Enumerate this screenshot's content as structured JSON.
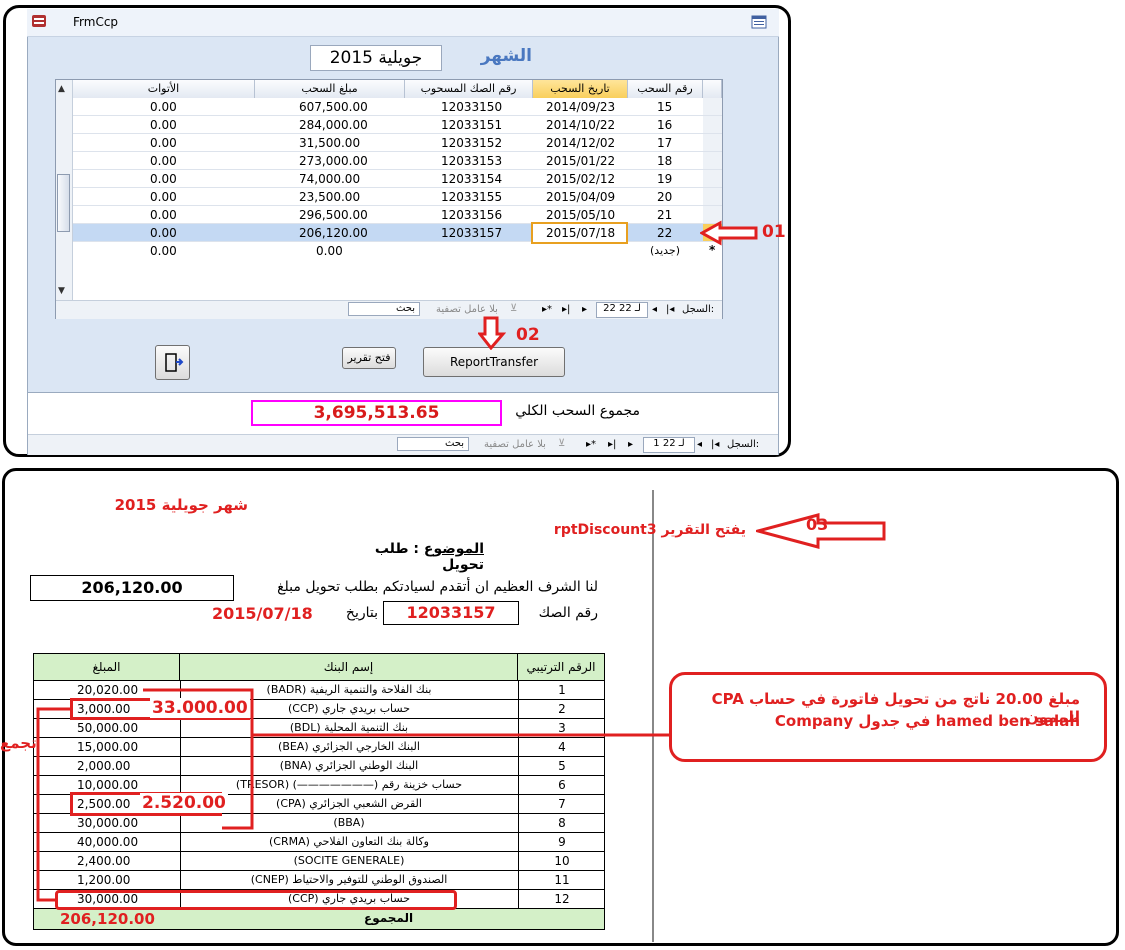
{
  "form": {
    "title": "FrmCcp",
    "month_label": "الشهر",
    "month_value": "جويلية 2015",
    "columns": [
      "رقم السحب",
      "تاريخ السحب",
      "رقم الصك المسحوب",
      "مبلغ السحب",
      "الأتوات"
    ],
    "rows": [
      {
        "num": "15",
        "date": "2014/09/23",
        "cheque": "12033150",
        "amount": "607,500.00",
        "fees": "0.00"
      },
      {
        "num": "16",
        "date": "2014/10/22",
        "cheque": "12033151",
        "amount": "284,000.00",
        "fees": "0.00"
      },
      {
        "num": "17",
        "date": "2014/12/02",
        "cheque": "12033152",
        "amount": "31,500.00",
        "fees": "0.00"
      },
      {
        "num": "18",
        "date": "2015/01/22",
        "cheque": "12033153",
        "amount": "273,000.00",
        "fees": "0.00"
      },
      {
        "num": "19",
        "date": "2015/02/12",
        "cheque": "12033154",
        "amount": "74,000.00",
        "fees": "0.00"
      },
      {
        "num": "20",
        "date": "2015/04/09",
        "cheque": "12033155",
        "amount": "23,500.00",
        "fees": "0.00"
      },
      {
        "num": "21",
        "date": "2015/05/10",
        "cheque": "12033156",
        "amount": "296,500.00",
        "fees": "0.00"
      },
      {
        "num": "22",
        "date": "2015/07/18",
        "cheque": "12033157",
        "amount": "206,120.00",
        "fees": "0.00"
      }
    ],
    "new_row": {
      "num": "(جديد)",
      "amount": "0.00",
      "fees": "0.00",
      "marker": "*"
    },
    "nav": {
      "record_label": "السجل:",
      "position": "22 لـ 22",
      "filter": "بلا عامل تصفية",
      "search": "بحث"
    },
    "open_report_button": "فتح تقرير",
    "report_transfer_button": "ReportTransfer",
    "total_label": "مجموع السحب الكلي",
    "total_value": "3,695,513.65",
    "bottom_nav": {
      "record_label": "السجل:",
      "position": "1 لـ 22",
      "filter": "بلا عامل تصفية",
      "search": "بحث"
    }
  },
  "annotations": {
    "a01": "01",
    "a02": "02",
    "a03": "03",
    "a03_text": "يفتح التقرير rptDiscount3",
    "sum_label": "تجمع",
    "callout_ccp": "33.000.00",
    "callout_cpa": "2.520.00",
    "note_line1": "مبلغ 20.00 ناتج من تحويل فاتورة في حساب CPA للممون",
    "note_line2": "hamed ben salah في جدول Company"
  },
  "report": {
    "month_title": "شهر جويلية 2015",
    "subject_label": "الموضوع",
    "subject_value": "طلب تحويل",
    "intro": "لنا الشرف العظيم ان أتقدم لسيادتكم بطلب تحويل مبلغ",
    "amount": "206,120.00",
    "cheque_label": "رقم الصك",
    "cheque_value": "12033157",
    "date_label": "بتاريخ",
    "date_value": "2015/07/18",
    "table_headers": [
      "الرقم الترتيبي",
      "إسم البنك",
      "المبلغ"
    ],
    "table_rows": [
      {
        "n": "1",
        "bank": "بنك الفلاحة والتنمية الريفية (BADR)",
        "amount": "20,020.00"
      },
      {
        "n": "2",
        "bank": "حساب بريدي جاري (CCP)",
        "amount": "3,000.00"
      },
      {
        "n": "3",
        "bank": "بنك التنمية المحلية (BDL)",
        "amount": "50,000.00"
      },
      {
        "n": "4",
        "bank": "البنك الخارجي الجزائري (BEA)",
        "amount": "15,000.00"
      },
      {
        "n": "5",
        "bank": "البنك الوطني الجزائري (BNA)",
        "amount": "2,000.00"
      },
      {
        "n": "6",
        "bank": "حساب خزينة رقم (———————) (TRESOR)",
        "amount": "10,000.00"
      },
      {
        "n": "7",
        "bank": "القرض الشعبي الجزائري (CPA)",
        "amount": "2,500.00"
      },
      {
        "n": "8",
        "bank": "(BBA)",
        "amount": "30,000.00"
      },
      {
        "n": "9",
        "bank": "وكالة بنك التعاون الفلاحي (CRMA)",
        "amount": "40,000.00"
      },
      {
        "n": "10",
        "bank": "(SOCITE GENERALE)",
        "amount": "2,400.00"
      },
      {
        "n": "11",
        "bank": "الصندوق الوطني للتوفير والاحتياط (CNEP)",
        "amount": "1,200.00"
      },
      {
        "n": "12",
        "bank": "حساب بريدي جاري (CCP)",
        "amount": "30,000.00"
      }
    ],
    "total_label": "المجموع",
    "total_value": "206,120.00"
  },
  "colors": {
    "accent_red": "#e02020",
    "form_bg": "#dbe6f4",
    "selected_row": "#c4d9f3",
    "header_green": "#d4f0c8",
    "total_border": "#ff00ff"
  }
}
